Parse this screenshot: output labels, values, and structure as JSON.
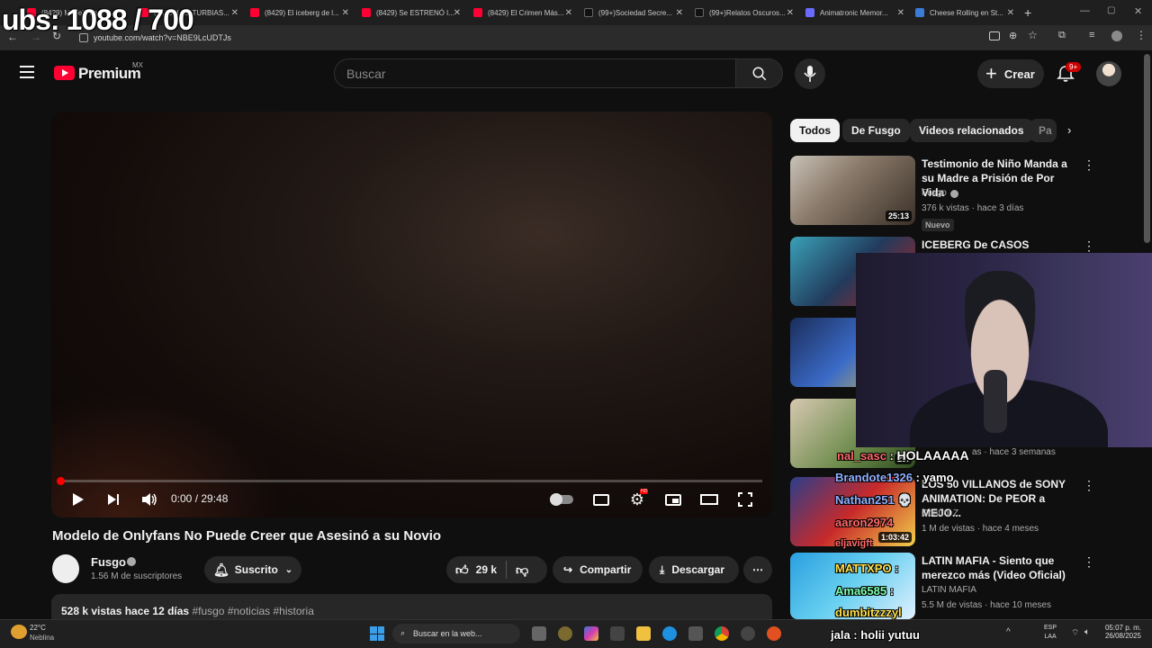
{
  "overlay": {
    "counter": "ubs: 1088 / 700"
  },
  "browser": {
    "tabs": [
      {
        "title": "(8429) Modelo de...",
        "icon": "youtube"
      },
      {
        "title": "(8429) LAS TURBIAS...",
        "icon": "youtube"
      },
      {
        "title": "(8429) El iceberg de l...",
        "icon": "youtube"
      },
      {
        "title": "(8429) Se ESTRENÓ l...",
        "icon": "youtube"
      },
      {
        "title": "(8429) El Crimen Más...",
        "icon": "youtube"
      },
      {
        "title": "(99+)Sociedad Secre...",
        "icon": "tiktok"
      },
      {
        "title": "(99+)Relatos Oscuros...",
        "icon": "tiktok"
      },
      {
        "title": "Animatronic Memor...",
        "icon": "generic"
      },
      {
        "title": "Cheese Rolling en St...",
        "icon": "generic"
      }
    ],
    "url": "youtube.com/watch?v=NBE9LcUDTJs"
  },
  "header": {
    "logo_text": "Premium",
    "region": "MX",
    "search_placeholder": "Buscar",
    "create_label": "Crear",
    "notif_count": "9+"
  },
  "player": {
    "time": "0:00 / 29:48",
    "progress": 0.0
  },
  "video": {
    "title": "Modelo de Onlyfans No Puede Creer que Asesinó a su Novio",
    "channel": "Fusgo",
    "subscribers": "1.56 M de suscriptores",
    "subscribed_label": "Suscrito",
    "likes": "29 k",
    "share_label": "Compartir",
    "download_label": "Descargar",
    "views_date": "528 k vistas  hace 12 días",
    "hashtags": "#fusgo #noticias #historia"
  },
  "chips": [
    "Todos",
    "De Fusgo",
    "Videos relacionados",
    "Pa"
  ],
  "related": [
    {
      "title": "Testimonio de Niño Manda a su Madre a Prisión de Por Vida",
      "channel": "Fusgo",
      "meta": "376 k vistas · hace 3 días",
      "duration": "25:13",
      "badge": "Nuevo"
    },
    {
      "title": "ICEBERG De CASOS",
      "channel": "",
      "meta": "",
      "duration": ""
    },
    {
      "title": "",
      "channel": "",
      "meta": "",
      "duration": ""
    },
    {
      "title": "",
      "channel": "",
      "meta": "as · hace 3 semanas",
      "duration": "29:"
    },
    {
      "title": "LOS 50 VILLANOS de SONY ANIMATION: De PEOR a MEJO...",
      "channel": "Control Z",
      "meta": "1 M de vistas · hace 4 meses",
      "duration": "1:03:42"
    },
    {
      "title": "LATIN MAFIA - Siento que merezco más (Video Oficial)",
      "channel": "LATIN MAFIA",
      "meta": "5.5 M de vistas · hace 10 meses",
      "duration": ""
    }
  ],
  "chat": [
    {
      "user": "nal_sasc",
      "msg": "HOLAAAAA"
    },
    {
      "user": "Brandote1326",
      "msg": "yamo"
    },
    {
      "user": "Nathan251",
      "msg": "💀"
    },
    {
      "user": "aaron2974",
      "msg": ""
    },
    {
      "user": "eljavigft",
      "msg": ""
    },
    {
      "user": "MATTXPO",
      "msg": ""
    },
    {
      "user": "Ama6585",
      "msg": ""
    },
    {
      "user": "dumbitzzzyl",
      "msg": ""
    },
    {
      "user": "jala",
      "msg": "holii yutuu"
    }
  ],
  "taskbar": {
    "weather_temp": "22°C",
    "weather_desc": "Neblina",
    "search_label": "Buscar en la web...",
    "lang": "ESP",
    "lang2": "LAA",
    "time": "05:07 p. m.",
    "date": "26/08/2025"
  }
}
